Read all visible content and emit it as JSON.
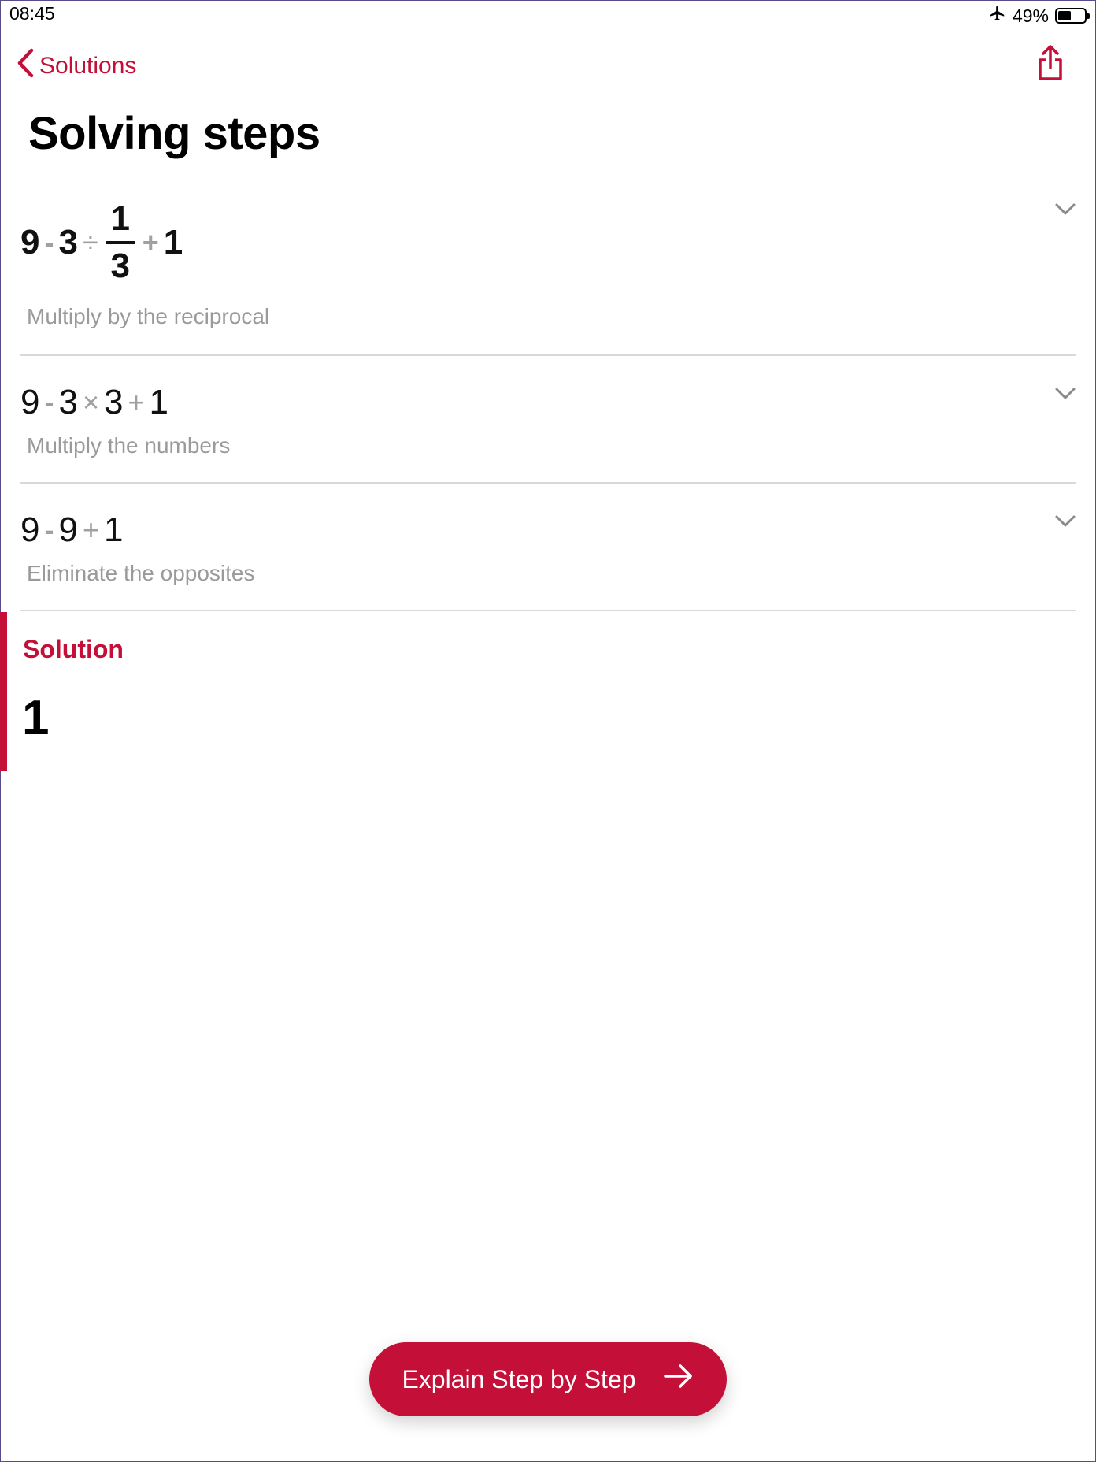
{
  "status_bar": {
    "time": "08:45",
    "battery_text": "49%",
    "airplane_icon": "airplane-icon",
    "battery_icon": "battery-icon"
  },
  "nav": {
    "back_label": "Solutions",
    "back_icon": "chevron-left-icon",
    "share_icon": "share-icon"
  },
  "page_title": "Solving steps",
  "steps": [
    {
      "tokens": [
        "9",
        "-",
        "3",
        "÷",
        "1",
        "3",
        "+",
        "1"
      ],
      "description": "Multiply by the reciprocal",
      "chevron_icon": "chevron-down-icon"
    },
    {
      "tokens": [
        "9",
        "-",
        "3",
        "×",
        "3",
        "+",
        "1"
      ],
      "description": "Multiply the numbers",
      "chevron_icon": "chevron-down-icon"
    },
    {
      "tokens": [
        "9",
        "-",
        "9",
        "+",
        "1"
      ],
      "description": "Eliminate the opposites",
      "chevron_icon": "chevron-down-icon"
    }
  ],
  "solution": {
    "label": "Solution",
    "value": "1"
  },
  "cta": {
    "label": "Explain Step by Step",
    "arrow_icon": "arrow-right-icon"
  },
  "colors": {
    "accent": "#c40f38",
    "muted_text": "#9a9a9a",
    "operator": "#a0a0a0",
    "divider": "#d9d9d9"
  }
}
